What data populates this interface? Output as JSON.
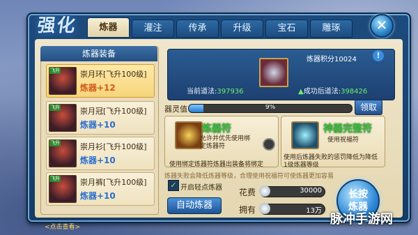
{
  "window": {
    "title": "强化",
    "close_icon": "close-icon"
  },
  "tabs": [
    {
      "label": "炼器",
      "active": true
    },
    {
      "label": "灌注",
      "active": false
    },
    {
      "label": "传承",
      "active": false
    },
    {
      "label": "升级",
      "active": false
    },
    {
      "label": "宝石",
      "active": false
    },
    {
      "label": "雕琢",
      "active": false
    }
  ],
  "equipment_panel": {
    "title": "炼器装备",
    "items": [
      {
        "name": "崇月环[飞升100级]",
        "level": "炼器+12",
        "selected": true,
        "badge": "飞升"
      },
      {
        "name": "崇月冠[飞升100级]",
        "level": "炼器+10",
        "selected": false,
        "badge": "飞升"
      },
      {
        "name": "崇月衫[飞升100级]",
        "level": "炼器+10",
        "selected": false,
        "badge": "飞升"
      },
      {
        "name": "崇月裤[飞升100级]",
        "level": "炼器+10",
        "selected": false,
        "badge": "飞升"
      }
    ],
    "hint": "<点击查看>"
  },
  "display": {
    "score_label": "炼器积分",
    "score_value": "10024",
    "current_label": "当前道法:",
    "current_value": "397936",
    "after_label": "成功后道法:",
    "after_value": "398426"
  },
  "spirit": {
    "label": "器灵值",
    "percent_text": "9%",
    "progress": 0.09,
    "claim_label": "领取"
  },
  "cards": {
    "refine_talisman": {
      "title": "炼器符",
      "desc": "允许并优先使用绑定炼器符",
      "note": "使用绑定炼器符炼器出装备将绑定"
    },
    "protect_talisman": {
      "title": "神器完整符",
      "desc": "使用祝福符",
      "note": "使用后炼器失败的惩罚降低为降低",
      "note2": "1级炼器等级"
    }
  },
  "warning": "炼器失败会降低炼器等级，合理使用祝福符可使炼器更加容易",
  "auto": {
    "checkbox_label": "开启轻点炼器",
    "checked": true,
    "button_label": "自动炼器"
  },
  "cost": {
    "cost_label": "花费",
    "cost_value": "30000",
    "own_label": "拥有",
    "own_value": "13万"
  },
  "hold_button": {
    "line1": "长按",
    "line2": "炼器"
  },
  "watermark": "脉冲手游网"
}
